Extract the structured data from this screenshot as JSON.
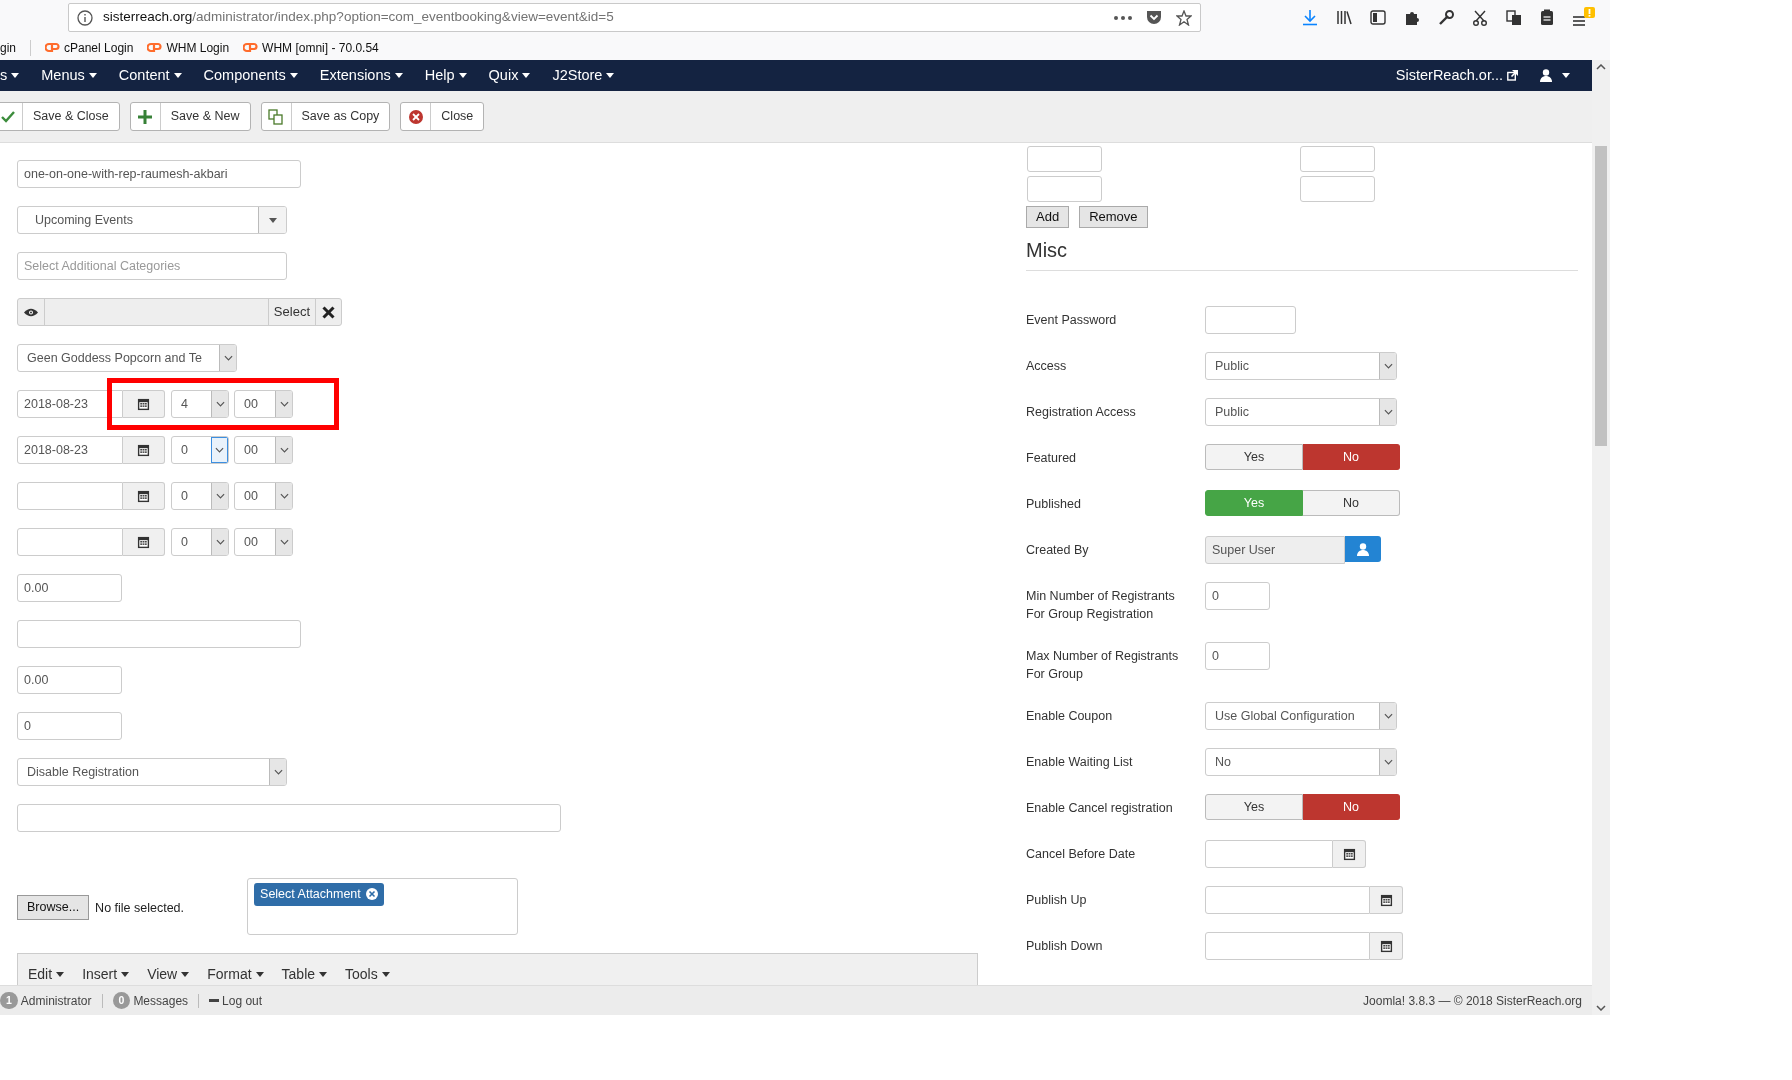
{
  "browser": {
    "url_host": "sisterreach.org",
    "url_path": "/administrator/index.php?option=com_eventbooking&view=event&id=5",
    "bookmarks": [
      {
        "label": "gin",
        "icon": false
      },
      {
        "label": "cPanel Login",
        "icon": true
      },
      {
        "label": "WHM Login",
        "icon": true
      },
      {
        "label": "WHM [omni] - 70.0.54",
        "icon": true
      }
    ]
  },
  "navbar": {
    "menus": [
      "s",
      "Menus",
      "Content",
      "Components",
      "Extensions",
      "Help",
      "Quix",
      "J2Store"
    ],
    "site_link": "SisterReach.or..."
  },
  "toolbar": [
    {
      "label": "Save & Close"
    },
    {
      "label": "Save & New"
    },
    {
      "label": "Save as Copy"
    },
    {
      "label": "Close"
    }
  ],
  "left_fields": [
    {
      "kind": "text",
      "value": "one-on-one-with-rep-raumesh-akbari"
    },
    {
      "kind": "chosen",
      "value": "Upcoming Events"
    },
    {
      "kind": "tags",
      "placeholder": "Select Additional Categories"
    },
    {
      "kind": "picker",
      "button": "Select"
    },
    {
      "kind": "select",
      "value": "Geen Goddess Popcorn and Te"
    },
    {
      "kind": "datetime",
      "date": "2018-08-23",
      "hour": "4",
      "minute": "00",
      "focused": false,
      "highlighted": true
    },
    {
      "kind": "datetime",
      "date": "2018-08-23",
      "hour": "0",
      "minute": "00",
      "focused": true,
      "highlighted": false
    },
    {
      "kind": "datetime",
      "hour": "0",
      "minute": "00",
      "focused": false,
      "highlighted": false
    },
    {
      "kind": "datetime",
      "hour": "0",
      "minute": "00",
      "focused": false,
      "highlighted": false
    },
    {
      "kind": "text",
      "value": "0.00"
    },
    {
      "kind": "text"
    },
    {
      "kind": "text",
      "value": "0.00"
    },
    {
      "kind": "text",
      "value": "0"
    },
    {
      "kind": "select",
      "value": "Disable Registration"
    },
    {
      "kind": "text"
    },
    {
      "kind": "upload",
      "button": "Browse...",
      "status": "No file selected.",
      "tag": "Select Attachment"
    }
  ],
  "editor_menu": [
    "Edit",
    "Insert",
    "View",
    "Format",
    "Table",
    "Tools"
  ],
  "right_buttons": [
    "Add",
    "Remove"
  ],
  "section_title": "Misc",
  "right_fields": [
    {
      "label": "Event Password",
      "kind": "text"
    },
    {
      "label": "Access",
      "kind": "select",
      "value": "Public"
    },
    {
      "label": "Registration Access",
      "kind": "select",
      "value": "Public"
    },
    {
      "label": "Featured",
      "kind": "toggle",
      "options": [
        {
          "label": "Yes",
          "selected": false
        },
        {
          "label": "No",
          "selected": true
        }
      ]
    },
    {
      "label": "Published",
      "kind": "toggle",
      "options": [
        {
          "label": "Yes",
          "selected": true
        },
        {
          "label": "No",
          "selected": false
        }
      ]
    },
    {
      "label": "Created By",
      "kind": "user",
      "value": "Super User"
    },
    {
      "label": "Min Number of Registrants For Group Registration",
      "kind": "text",
      "value": "0"
    },
    {
      "label": "Max Number of Registrants For Group",
      "kind": "text",
      "value": "0"
    },
    {
      "label": "Enable Coupon",
      "kind": "select",
      "value": "Use Global Configuration"
    },
    {
      "label": "Enable Waiting List",
      "kind": "select",
      "value": "No"
    },
    {
      "label": "Enable Cancel registration",
      "kind": "toggle",
      "options": [
        {
          "label": "Yes",
          "selected": false
        },
        {
          "label": "No",
          "selected": true
        }
      ]
    },
    {
      "label": "Cancel Before Date",
      "kind": "date"
    },
    {
      "label": "Publish Up",
      "kind": "date"
    },
    {
      "label": "Publish Down",
      "kind": "date"
    }
  ],
  "status_bar": {
    "items": [
      {
        "kind": "count",
        "count": "1",
        "label": "Administrator"
      },
      {
        "kind": "count",
        "count": "0",
        "label": "Messages"
      },
      {
        "kind": "logout",
        "label": "Log out"
      }
    ],
    "footer": "Joomla! 3.8.3 — © 2018 SisterReach.org"
  }
}
